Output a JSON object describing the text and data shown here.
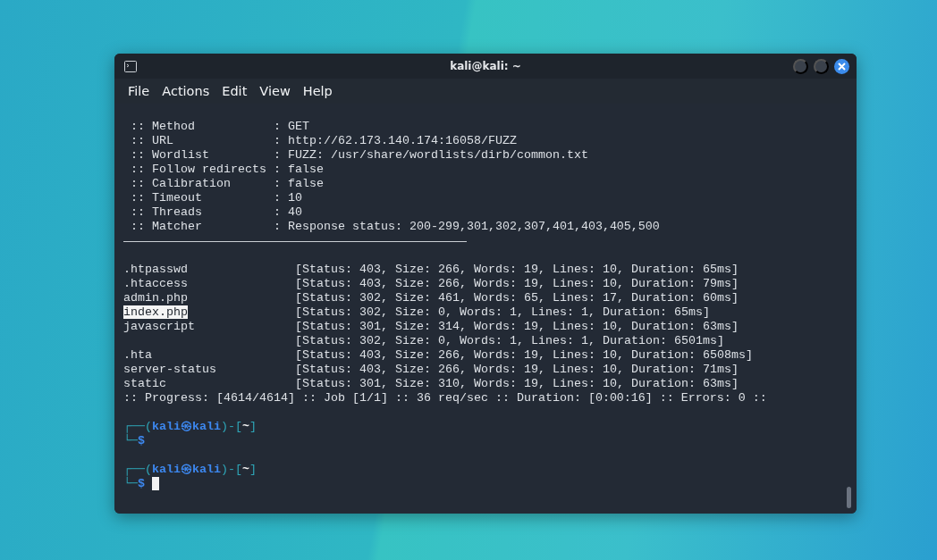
{
  "window": {
    "title": "kali@kali: ~"
  },
  "menu": [
    "File",
    "Actions",
    "Edit",
    "View",
    "Help"
  ],
  "config_lines": [
    " :: Method           : GET",
    " :: URL              : http://62.173.140.174:16058/FUZZ",
    " :: Wordlist         : FUZZ: /usr/share/wordlists/dirb/common.txt",
    " :: Follow redirects : false",
    " :: Calibration      : false",
    " :: Timeout          : 10",
    " :: Threads          : 40",
    " :: Matcher          : Response status: 200-299,301,302,307,401,403,405,500"
  ],
  "results": [
    {
      "name": ".htpasswd",
      "result": "[Status: 403, Size: 266, Words: 19, Lines: 10, Duration: 65ms]",
      "highlighted": false
    },
    {
      "name": ".htaccess",
      "result": "[Status: 403, Size: 266, Words: 19, Lines: 10, Duration: 79ms]",
      "highlighted": false
    },
    {
      "name": "admin.php",
      "result": "[Status: 302, Size: 461, Words: 65, Lines: 17, Duration: 60ms]",
      "highlighted": false
    },
    {
      "name": "index.php",
      "result": "[Status: 302, Size: 0, Words: 1, Lines: 1, Duration: 65ms]",
      "highlighted": true
    },
    {
      "name": "javascript",
      "result": "[Status: 301, Size: 314, Words: 19, Lines: 10, Duration: 63ms]",
      "highlighted": false
    },
    {
      "result": "[Status: 302, Size: 0, Words: 1, Lines: 1, Duration: 6501ms]",
      "highlighted": false
    },
    {
      "name": ".hta",
      "result": "[Status: 403, Size: 266, Words: 19, Lines: 10, Duration: 6508ms]",
      "highlighted": false
    },
    {
      "name": "server-status",
      "result": "[Status: 403, Size: 266, Words: 19, Lines: 10, Duration: 71ms]",
      "highlighted": false
    },
    {
      "name": "static",
      "result": "[Status: 301, Size: 310, Words: 19, Lines: 10, Duration: 63ms]",
      "highlighted": false
    }
  ],
  "progress_line": ":: Progress: [4614/4614] :: Job [1/1] :: 36 req/sec :: Duration: [0:00:16] :: Errors: 0 ::",
  "prompts": [
    {
      "open": "┌──(",
      "user": "kali",
      "at": "㉿",
      "host": "kali",
      "mid": ")-[",
      "dir": "~",
      "close": "]",
      "corner": "└─",
      "symbol": "$",
      "cursor": false
    },
    {
      "open": "┌──(",
      "user": "kali",
      "at": "㉿",
      "host": "kali",
      "mid": ")-[",
      "dir": "~",
      "close": "]",
      "corner": "└─",
      "symbol": "$",
      "cursor": true
    }
  ]
}
